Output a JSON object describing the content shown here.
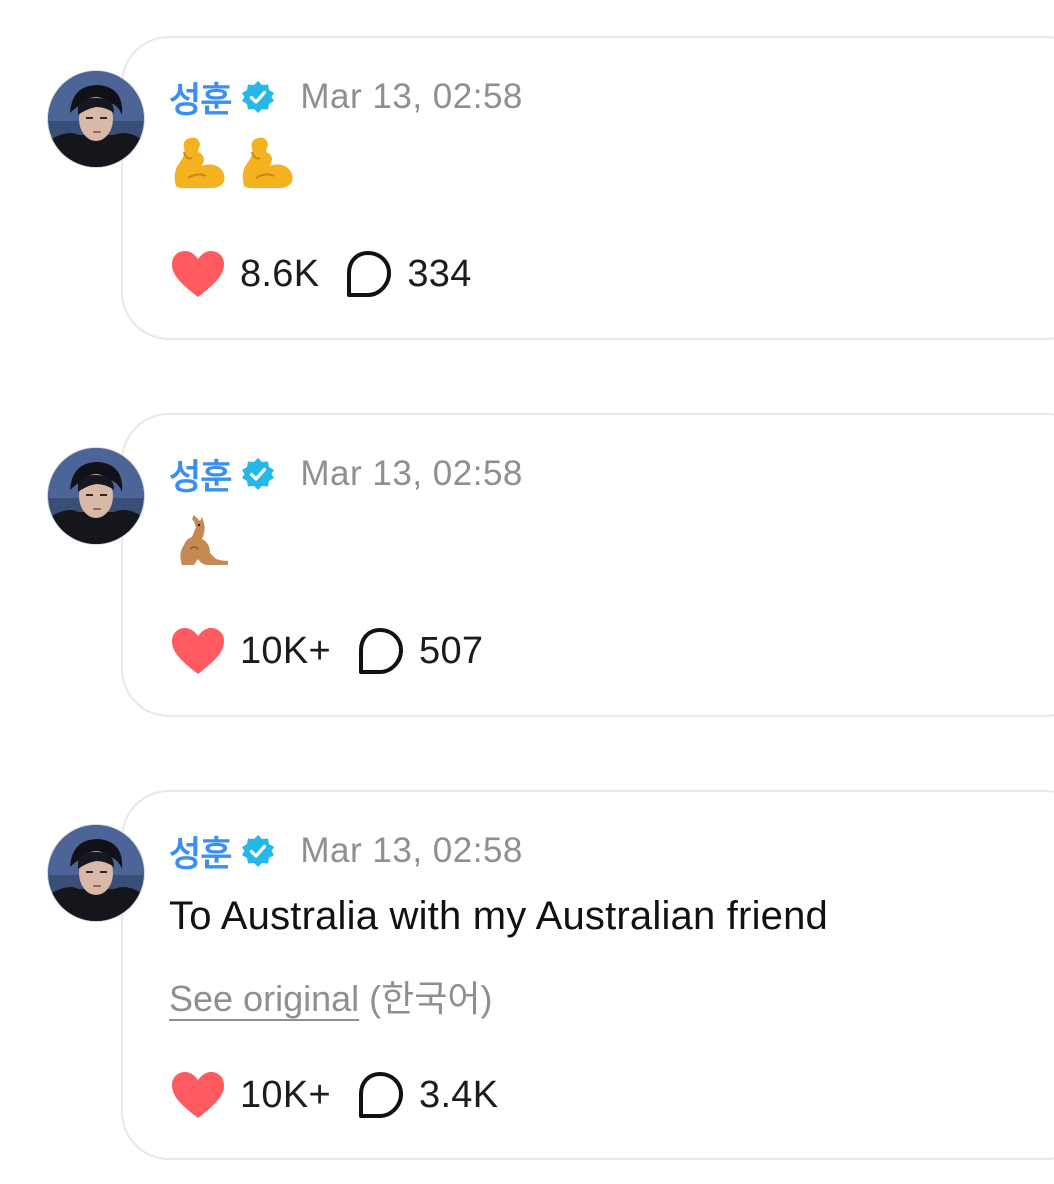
{
  "posts": [
    {
      "username": "성훈",
      "verified": true,
      "timestamp": "Mar 13, 02:58",
      "content_emojis": [
        "flexed-biceps",
        "flexed-biceps"
      ],
      "likes": "8.6K",
      "comments": "334"
    },
    {
      "username": "성훈",
      "verified": true,
      "timestamp": "Mar 13, 02:58",
      "content_emojis": [
        "kangaroo"
      ],
      "likes": "10K+",
      "comments": "507"
    },
    {
      "username": "성훈",
      "verified": true,
      "timestamp": "Mar 13, 02:58",
      "text": "To Australia with my Australian friend",
      "see_original_label": "See original",
      "original_language": "(한국어)",
      "likes": "10K+",
      "comments": "3.4K"
    }
  ],
  "colors": {
    "username": "#3a8ff0",
    "verified_badge": "#25b8e6",
    "timestamp": "#8e8e93",
    "heart": "#ff5a5f",
    "card_border": "#e7e7ec"
  },
  "icons": {
    "like": "heart-icon",
    "comment": "speech-bubble-icon",
    "verified": "verified-badge-icon"
  }
}
